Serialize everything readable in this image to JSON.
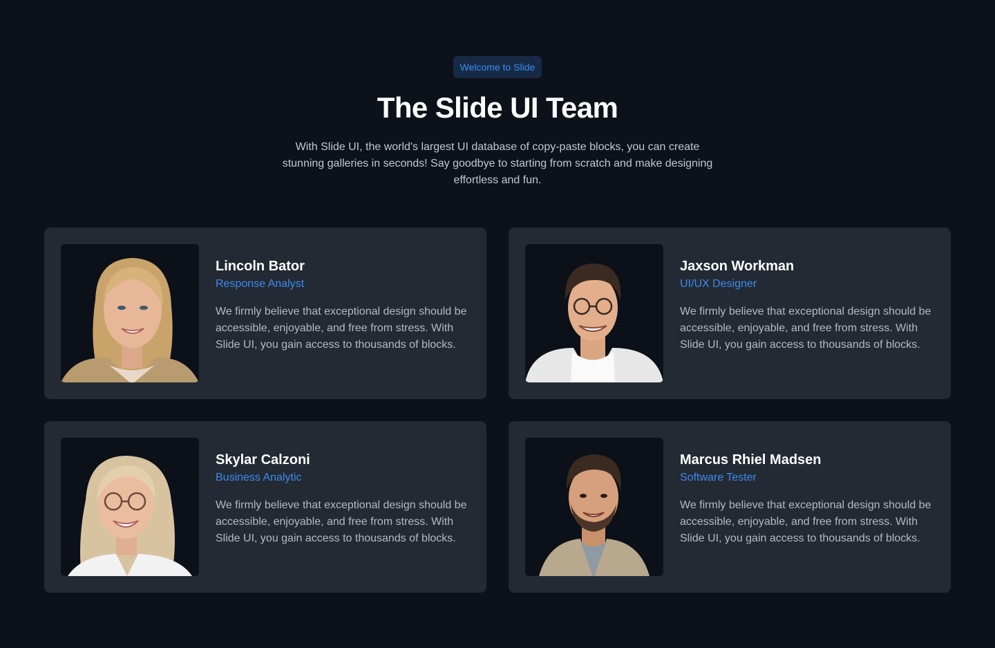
{
  "header": {
    "badge": "Welcome to Slide",
    "title": "The Slide UI Team",
    "subtitle": "With Slide UI, the world's largest UI database of copy-paste blocks, you can create stunning galleries in seconds! Say goodbye to starting from scratch and make designing effortless and fun."
  },
  "team": [
    {
      "name": "Lincoln Bator",
      "role": "Response Analyst",
      "bio": "We firmly believe that exceptional design should be accessible, enjoyable, and free from stress. With Slide UI, you gain access to thousands of blocks."
    },
    {
      "name": "Jaxson Workman",
      "role": "UI/UX Designer",
      "bio": "We firmly believe that exceptional design should be accessible, enjoyable, and free from stress. With Slide UI, you gain access to thousands of blocks."
    },
    {
      "name": "Skylar Calzoni",
      "role": "Business Analytic",
      "bio": "We firmly believe that exceptional design should be accessible, enjoyable, and free from stress. With Slide UI, you gain access to thousands of blocks."
    },
    {
      "name": "Marcus Rhiel Madsen",
      "role": "Software Tester",
      "bio": "We firmly believe that exceptional design should be accessible, enjoyable, and free from stress. With Slide UI, you gain access to thousands of blocks."
    }
  ],
  "colors": {
    "background": "#0d111a",
    "card": "#232a33",
    "accent": "#3d8bf2",
    "badge_bg": "#172a45"
  }
}
